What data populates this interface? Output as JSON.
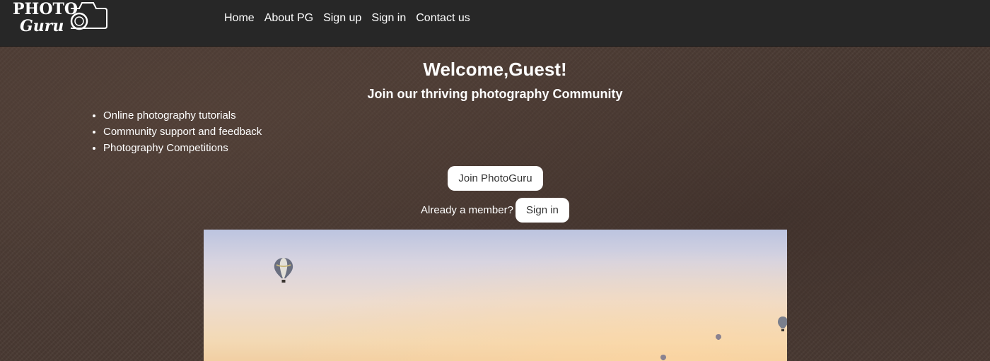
{
  "brand": {
    "line1": "PHOTO",
    "line2": "Guru"
  },
  "nav": {
    "links": [
      "Home",
      "About PG",
      "Sign up",
      "Sign in",
      "Contact us"
    ]
  },
  "hero_text": {
    "title": "Welcome,Guest!",
    "subtitle": "Join our thriving photography Community"
  },
  "features": [
    "Online photography tutorials",
    "Community support and feedback",
    "Photography Competitions"
  ],
  "actions": {
    "join_label": "Join PhotoGuru",
    "member_prompt": "Already a member?",
    "signin_label": "Sign in"
  },
  "colors": {
    "navbar": "#272727",
    "background": "#4a3a33",
    "button_bg": "#ffffff",
    "button_text": "#333333"
  },
  "image": {
    "subject": "hot-air-balloons-at-dawn-image"
  }
}
